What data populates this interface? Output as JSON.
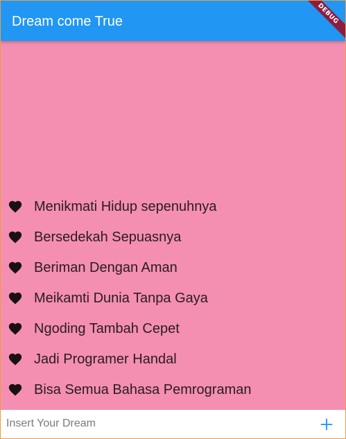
{
  "appbar": {
    "title": "Dream come True",
    "debug_label": "DEBUG"
  },
  "colors": {
    "appbar": "#2196f3",
    "background": "#f48fb1",
    "heart": "#1a1014",
    "add_icon": "#2196f3"
  },
  "dreams": [
    {
      "icon": "heart-icon",
      "label": "Menikmati Hidup sepenuhnya"
    },
    {
      "icon": "heart-icon",
      "label": "Bersedekah Sepuasnya"
    },
    {
      "icon": "heart-icon",
      "label": "Beriman Dengan Aman"
    },
    {
      "icon": "heart-icon",
      "label": "Meikamti Dunia Tanpa Gaya"
    },
    {
      "icon": "heart-icon",
      "label": "Ngoding Tambah Cepet"
    },
    {
      "icon": "heart-icon",
      "label": "Jadi Programer Handal"
    },
    {
      "icon": "heart-icon",
      "label": "Bisa Semua Bahasa Pemrograman"
    }
  ],
  "input": {
    "placeholder": "Insert Your Dream",
    "value": "",
    "add_icon": "plus-icon"
  }
}
